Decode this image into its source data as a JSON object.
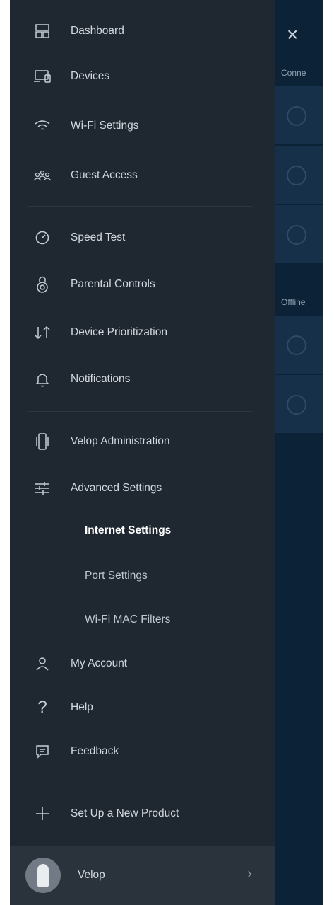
{
  "background": {
    "close_glyph": "×",
    "section_connected": "Conne",
    "section_offline": "Offline"
  },
  "menu": {
    "dashboard": "Dashboard",
    "devices": "Devices",
    "wifi_settings": "Wi-Fi Settings",
    "guest_access": "Guest Access",
    "speed_test": "Speed Test",
    "parental_controls": "Parental Controls",
    "device_prioritization": "Device Prioritization",
    "notifications": "Notifications",
    "velop_administration": "Velop Administration",
    "advanced_settings": "Advanced Settings",
    "internet_settings": "Internet Settings",
    "port_settings": "Port Settings",
    "wifi_mac_filters": "Wi-Fi MAC Filters",
    "my_account": "My Account",
    "help": "Help",
    "feedback": "Feedback",
    "setup_new_product": "Set Up a New Product"
  },
  "footer": {
    "network_name": "Velop",
    "chevron": "›"
  },
  "colors": {
    "drawer_bg": "#1f2730",
    "content_bg": "#0c2236",
    "row_bg": "#163049",
    "text": "#d3d8de",
    "active_text": "#ffffff"
  },
  "icons": [
    "dashboard-icon",
    "devices-icon",
    "wifi-icon",
    "guest-icon",
    "speedometer-icon",
    "parental-icon",
    "priority-arrows-icon",
    "bell-icon",
    "router-node-icon",
    "sliders-icon",
    "person-icon",
    "question-icon",
    "chat-icon",
    "plus-icon",
    "close-icon",
    "chevron-right-icon"
  ]
}
